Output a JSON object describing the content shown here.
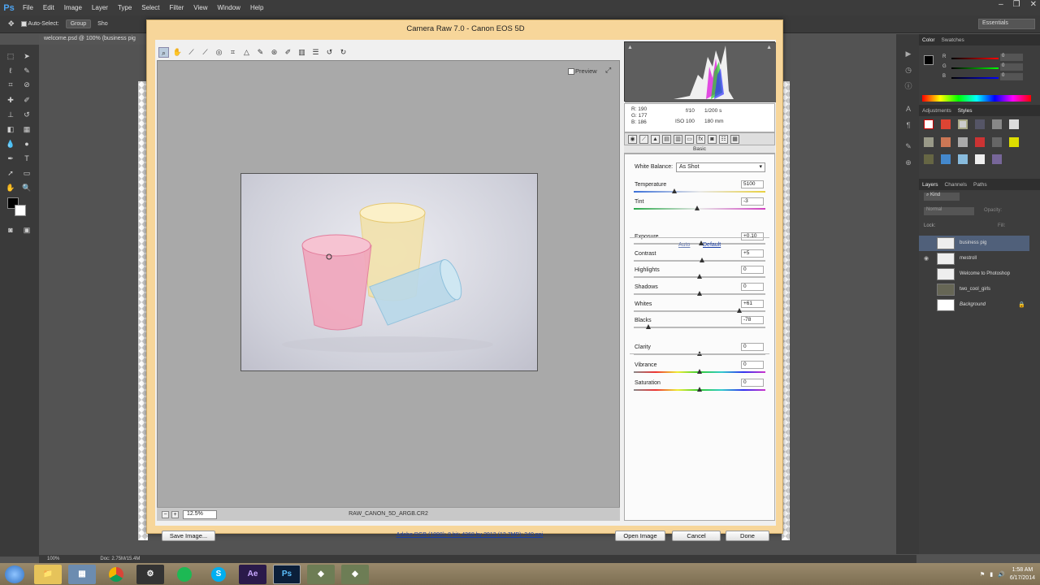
{
  "ps": {
    "logo": "Ps",
    "menu": [
      "File",
      "Edit",
      "Image",
      "Layer",
      "Type",
      "Select",
      "Filter",
      "View",
      "Window",
      "Help"
    ],
    "options": {
      "auto_select": "Auto-Select:",
      "group": "Group",
      "show": "Sho"
    },
    "workspace": "Essentials",
    "doc_tab": "welcome.psd @ 100% (business pig",
    "status_zoom": "100%",
    "status_doc": "Doc: 2.75M/15.4M"
  },
  "camera_raw": {
    "title": "Camera Raw 7.0  -  Canon EOS 5D",
    "preview_label": "Preview",
    "zoom": "12.5%",
    "filename": "RAW_CANON_5D_ARGB.CR2",
    "save_image": "Save Image...",
    "workflow": "Adobe RGB (1998); 8 bit; 4368 by 2912 (12.7MP); 240 ppi",
    "open_image": "Open Image",
    "cancel": "Cancel",
    "done": "Done",
    "readout": {
      "r": "R:  190",
      "g": "G:  177",
      "b": "B:  186",
      "aperture": "f/10",
      "shutter": "1/200 s",
      "iso": "ISO 100",
      "focal": "180 mm"
    },
    "panel_title": "Basic",
    "white_balance_label": "White Balance:",
    "white_balance_value": "As Shot",
    "auto": "Auto",
    "default": "Default",
    "adjustments": [
      {
        "label": "Temperature",
        "value": "5100",
        "pos": 0.31
      },
      {
        "label": "Tint",
        "value": "-3",
        "pos": 0.48
      },
      {
        "label": "Exposure",
        "value": "+0.10",
        "pos": 0.51
      },
      {
        "label": "Contrast",
        "value": "+5",
        "pos": 0.52
      },
      {
        "label": "Highlights",
        "value": "0",
        "pos": 0.5
      },
      {
        "label": "Shadows",
        "value": "0",
        "pos": 0.5
      },
      {
        "label": "Whites",
        "value": "+61",
        "pos": 0.8
      },
      {
        "label": "Blacks",
        "value": "-78",
        "pos": 0.11
      },
      {
        "label": "Clarity",
        "value": "0",
        "pos": 0.5
      },
      {
        "label": "Vibrance",
        "value": "0",
        "pos": 0.5
      },
      {
        "label": "Saturation",
        "value": "0",
        "pos": 0.5
      }
    ]
  },
  "panels": {
    "color_tabs": [
      "Color",
      "Swatches"
    ],
    "color_values": {
      "r": "0",
      "g": "0",
      "b": "0"
    },
    "color_labels": {
      "r": "R",
      "g": "G",
      "b": "B"
    },
    "adj_tabs": [
      "Adjustments",
      "Styles"
    ],
    "layer_tabs": [
      "Layers",
      "Channels",
      "Paths"
    ],
    "kind": "Kind",
    "blend": "Normal",
    "opacity_label": "Opacity:",
    "lock_label": "Lock:",
    "fill_label": "Fill:",
    "layers": [
      "business pig",
      "mestroll",
      "Welcome to Photoshop",
      "two_cool_girls",
      "Background"
    ]
  },
  "taskbar": {
    "apps": [
      "Ae",
      "Ps"
    ],
    "time": "1:58 AM",
    "date": "6/17/2014"
  },
  "colors": {
    "dialog_frame": "#f7d69a",
    "ps_dark": "#3a3a3a",
    "link": "#1a3fa8"
  }
}
